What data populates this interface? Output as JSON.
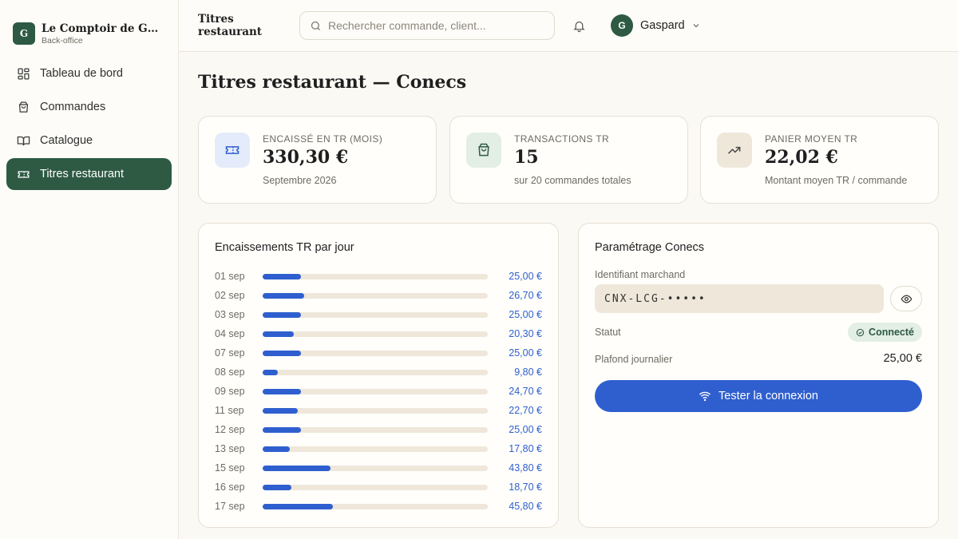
{
  "brand": {
    "logo_letter": "G",
    "name": "Le Comptoir de Gaspard",
    "subtitle": "Back-office"
  },
  "sidebar": {
    "items": [
      {
        "label": "Tableau de bord",
        "icon": "dashboard-icon",
        "active": false
      },
      {
        "label": "Commandes",
        "icon": "shopping-bag-icon",
        "active": false
      },
      {
        "label": "Catalogue",
        "icon": "book-icon",
        "active": false
      },
      {
        "label": "Titres restaurant",
        "icon": "ticket-icon",
        "active": true
      }
    ]
  },
  "header": {
    "title": "Titres restaurant",
    "search_placeholder": "Rechercher commande, client...",
    "user": {
      "initial": "G",
      "name": "Gaspard"
    }
  },
  "page": {
    "title": "Titres restaurant — Conecs"
  },
  "stats": [
    {
      "label": "Encaissé en TR (mois)",
      "value": "330,30 €",
      "sub": "Septembre 2026",
      "icon": "ticket-icon",
      "icon_bg": "#e4ebfa",
      "icon_color": "#2f5fcf"
    },
    {
      "label": "Transactions TR",
      "value": "15",
      "sub": "sur 20 commandes totales",
      "icon": "shopping-bag-icon",
      "icon_bg": "#e3eee5",
      "icon_color": "#2e5a44"
    },
    {
      "label": "Panier moyen TR",
      "value": "22,02 €",
      "sub": "Montant moyen TR / commande",
      "icon": "trending-up-icon",
      "icon_bg": "#efe7da",
      "icon_color": "#4a4a4a"
    }
  ],
  "daily": {
    "title": "Encaissements TR par jour",
    "scale_max": 146
  },
  "chart_data": {
    "type": "bar",
    "title": "Encaissements TR par jour",
    "categories": [
      "01 sep",
      "02 sep",
      "03 sep",
      "04 sep",
      "07 sep",
      "08 sep",
      "09 sep",
      "11 sep",
      "12 sep",
      "13 sep",
      "15 sep",
      "16 sep",
      "17 sep"
    ],
    "values": [
      25.0,
      26.7,
      25.0,
      20.3,
      25.0,
      9.8,
      24.7,
      22.7,
      25.0,
      17.8,
      43.8,
      18.7,
      45.8
    ],
    "value_labels": [
      "25,00 €",
      "26,70 €",
      "25,00 €",
      "20,30 €",
      "25,00 €",
      "9,80 €",
      "24,70 €",
      "22,70 €",
      "25,00 €",
      "17,80 €",
      "43,80 €",
      "18,70 €",
      "45,80 €"
    ],
    "color": "#2f5fcf",
    "orientation": "horizontal"
  },
  "settings": {
    "title": "Paramétrage Conecs",
    "merchant_label": "Identifiant marchand",
    "merchant_value": "CNX-LCG-•••••",
    "status_label": "Statut",
    "status_value": "Connecté",
    "ceiling_label": "Plafond journalier",
    "ceiling_value": "25,00 €",
    "test_button": "Tester la connexion"
  }
}
